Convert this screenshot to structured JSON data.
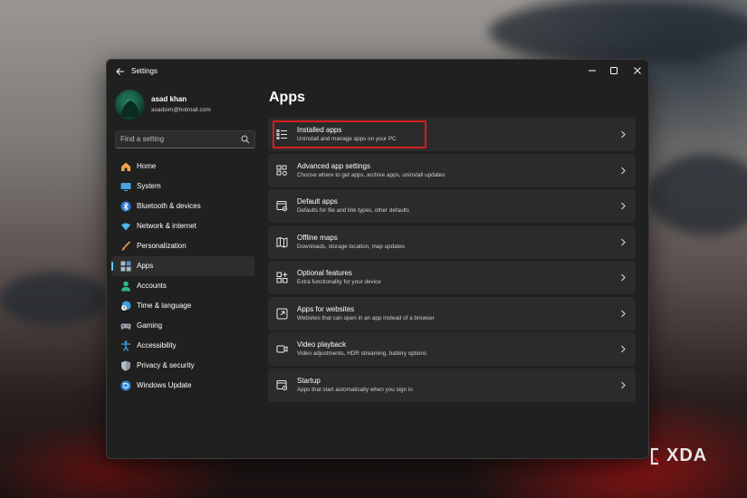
{
  "window": {
    "title": "Settings"
  },
  "profile": {
    "name": "asad khan",
    "email": "asadsim@hotmail.com"
  },
  "search": {
    "placeholder": "Find a setting"
  },
  "nav": [
    {
      "label": "Home",
      "icon": "home-icon",
      "active": false
    },
    {
      "label": "System",
      "icon": "system-icon",
      "active": false
    },
    {
      "label": "Bluetooth & devices",
      "icon": "bluetooth-icon",
      "active": false
    },
    {
      "label": "Network & internet",
      "icon": "network-icon",
      "active": false
    },
    {
      "label": "Personalization",
      "icon": "brush-icon",
      "active": false
    },
    {
      "label": "Apps",
      "icon": "apps-icon",
      "active": true
    },
    {
      "label": "Accounts",
      "icon": "accounts-icon",
      "active": false
    },
    {
      "label": "Time & language",
      "icon": "time-language-icon",
      "active": false
    },
    {
      "label": "Gaming",
      "icon": "gaming-icon",
      "active": false
    },
    {
      "label": "Accessibility",
      "icon": "accessibility-icon",
      "active": false
    },
    {
      "label": "Privacy & security",
      "icon": "shield-icon",
      "active": false
    },
    {
      "label": "Windows Update",
      "icon": "update-icon",
      "active": false
    }
  ],
  "page": {
    "title": "Apps"
  },
  "cards": [
    {
      "title": "Installed apps",
      "subtitle": "Uninstall and manage apps on your PC",
      "icon": "list-icon",
      "highlighted": true
    },
    {
      "title": "Advanced app settings",
      "subtitle": "Choose where to get apps, archive apps, uninstall updates",
      "icon": "app-settings-icon",
      "highlighted": false
    },
    {
      "title": "Default apps",
      "subtitle": "Defaults for file and link types, other defaults",
      "icon": "default-apps-icon",
      "highlighted": false
    },
    {
      "title": "Offline maps",
      "subtitle": "Downloads, storage location, map updates",
      "icon": "map-icon",
      "highlighted": false
    },
    {
      "title": "Optional features",
      "subtitle": "Extra functionality for your device",
      "icon": "optional-features-icon",
      "highlighted": false
    },
    {
      "title": "Apps for websites",
      "subtitle": "Websites that can open in an app instead of a browser",
      "icon": "web-app-icon",
      "highlighted": false
    },
    {
      "title": "Video playback",
      "subtitle": "Video adjustments, HDR streaming, battery options",
      "icon": "video-icon",
      "highlighted": false
    },
    {
      "title": "Startup",
      "subtitle": "Apps that start automatically when you sign in",
      "icon": "startup-icon",
      "highlighted": false
    }
  ],
  "watermark": {
    "text": "XDA"
  },
  "colors": {
    "accent": "#60cdff",
    "highlight": "#d31f1f",
    "window_bg": "#202020",
    "card_bg": "#2b2b2b"
  }
}
